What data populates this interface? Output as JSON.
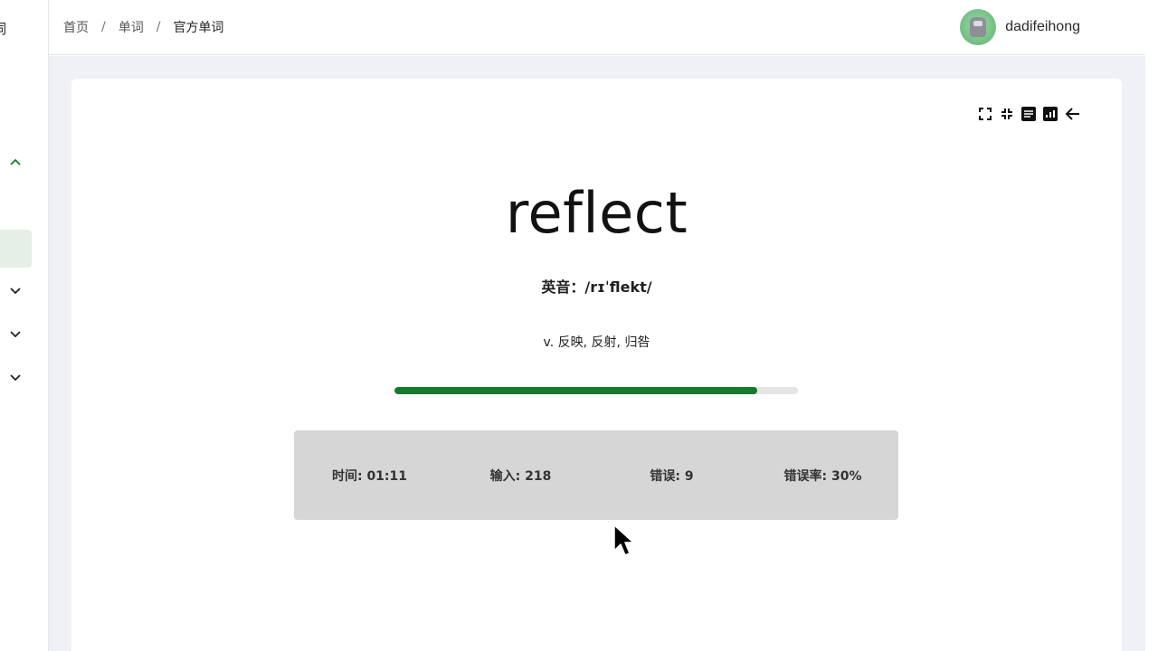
{
  "sidebar": {
    "cut_label": "词",
    "expanded_group_icon": "chevron-up-icon",
    "collapsed_group_icon": "chevron-down-icon"
  },
  "breadcrumb": {
    "items": [
      "首页",
      "单词",
      "官方单词"
    ],
    "separator": "/"
  },
  "user": {
    "name": "dadifeihong"
  },
  "toolbar": {
    "icons": [
      "fullscreen-icon",
      "exit-fullscreen-icon",
      "article-icon",
      "bar-chart-icon",
      "arrow-back-icon"
    ]
  },
  "word": {
    "text": "reflect",
    "phonetic": "英音：/rɪˈflekt/",
    "translation": "v. 反映, 反射, 归咎"
  },
  "progress": {
    "fraction": 0.9
  },
  "stats": {
    "time": "时间: 01:11",
    "input": "输入: 218",
    "errors": "错误: 9",
    "error_rate": "错误率: 30%"
  },
  "colors": {
    "accent": "#157a2d",
    "background": "#f0f1f6",
    "stats_bg": "#d6d6d6"
  }
}
